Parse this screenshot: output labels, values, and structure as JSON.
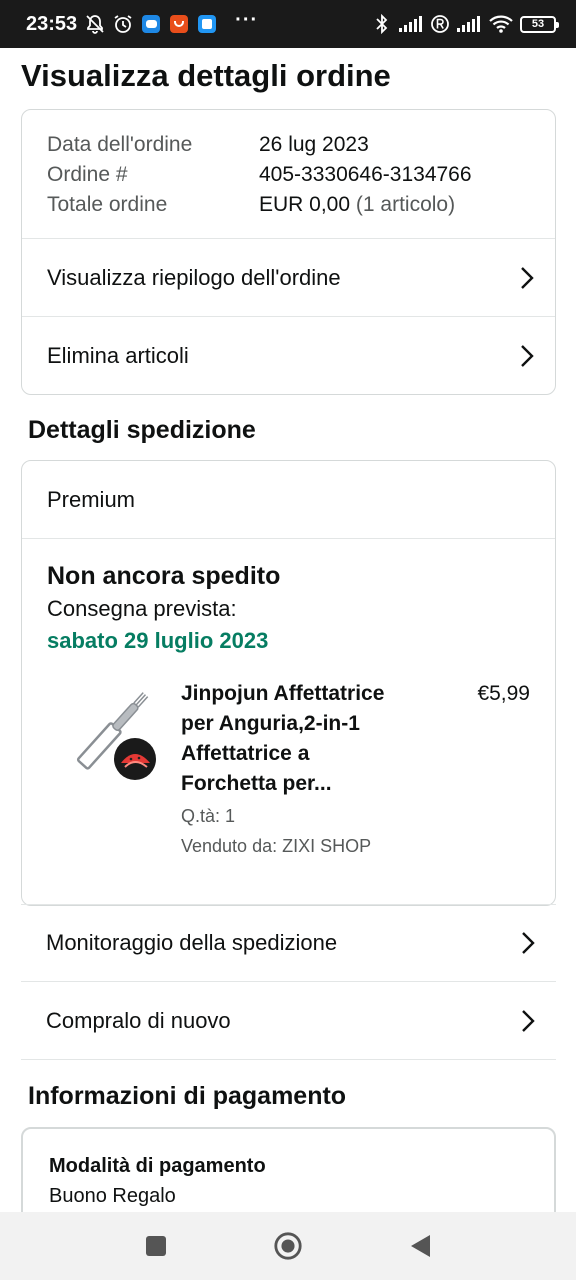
{
  "status_bar": {
    "time": "23:53",
    "battery": "53",
    "more": "···"
  },
  "page_title": "Visualizza dettagli ordine",
  "order": {
    "date_label": "Data dell'ordine",
    "date_value": "26 lug 2023",
    "number_label": "Ordine #",
    "number_value": "405-3330646-3134766",
    "total_label": "Totale ordine",
    "total_value": "EUR 0,00",
    "total_items": "(1 articolo)",
    "summary_link": "Visualizza riepilogo dell'ordine",
    "delete_link": "Elimina articoli"
  },
  "shipment": {
    "section_title": "Dettagli spedizione",
    "method": "Premium",
    "status": "Non ancora spedito",
    "expected_label": "Consegna prevista:",
    "expected_date": "sabato 29 luglio 2023",
    "product": {
      "name": "Jinpojun Affettatrice per Anguria,2-in-1 Affettatrice a Forchetta per...",
      "price": "€5,99",
      "quantity": "Q.tà: 1",
      "seller": "Venduto da: ZIXI SHOP"
    },
    "track_link": "Monitoraggio della spedizione",
    "buy_again_link": "Compralo di nuovo"
  },
  "payment": {
    "section_title": "Informazioni di pagamento",
    "method_label": "Modalità di pagamento",
    "method_value": "Buono Regalo"
  },
  "colors": {
    "delivery_green": "#067d62",
    "status_bar": "#1a1a1a",
    "border": "#d5d9d9"
  }
}
